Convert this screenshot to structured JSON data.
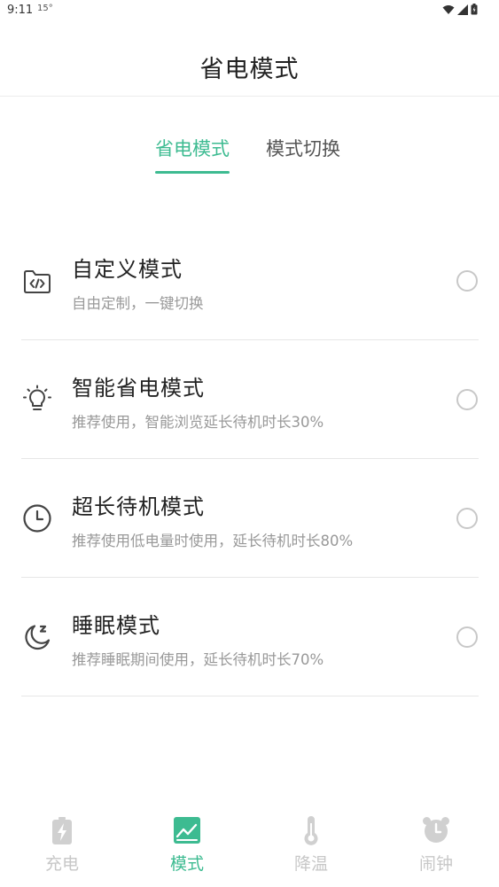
{
  "status_bar": {
    "time": "9:11",
    "extra": "15°",
    "icons": [
      "wifi-icon",
      "signal-icon",
      "battery-icon"
    ]
  },
  "header": {
    "title": "省电模式"
  },
  "tabs": [
    {
      "label": "省电模式",
      "active": true
    },
    {
      "label": "模式切换",
      "active": false
    }
  ],
  "modes": [
    {
      "icon": "custom-code-folder-icon",
      "title": "自定义模式",
      "desc": "自由定制，一键切换",
      "selected": false
    },
    {
      "icon": "lightbulb-icon",
      "title": "智能省电模式",
      "desc": "推荐使用，智能浏览延长待机时长30%",
      "selected": false
    },
    {
      "icon": "clock-icon",
      "title": "超长待机模式",
      "desc": "推荐使用低电量时使用，延长待机时长80%",
      "selected": false
    },
    {
      "icon": "moon-sleep-icon",
      "title": "睡眠模式",
      "desc": "推荐睡眠期间使用，延长待机时长70%",
      "selected": false
    }
  ],
  "bottom_nav": [
    {
      "label": "充电",
      "icon": "battery-charge-icon",
      "active": false
    },
    {
      "label": "模式",
      "icon": "mode-chart-icon",
      "active": true
    },
    {
      "label": "降温",
      "icon": "thermometer-icon",
      "active": false
    },
    {
      "label": "闹钟",
      "icon": "alarm-clock-icon",
      "active": false
    }
  ],
  "colors": {
    "accent": "#3dbb91",
    "inactive": "#c7c7c7",
    "text_primary": "#222222",
    "text_secondary": "#999999"
  }
}
